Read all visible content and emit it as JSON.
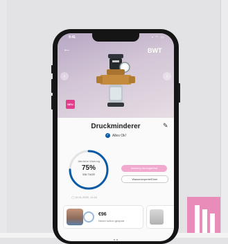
{
  "status_bar": {
    "time": "9:41",
    "icons": "▪ ◠ ▭"
  },
  "header": {
    "back_label": "←",
    "brand": "BWT"
  },
  "hero": {
    "prev_label": "‹",
    "next_label": "›",
    "sticker_text": "NEU"
  },
  "device": {
    "title": "Druckminderer",
    "status": "Alles Ok!"
  },
  "maintenance": {
    "caption": "Jährliche Wartung",
    "percent_text": "75%",
    "progress_fraction": 0.75,
    "days_text": "336 TAGE",
    "date_text": "10.01.2025, 14:24",
    "primary_action": "Wartung durchgeführt",
    "secondary_action": "Wasserexperte/Einer"
  },
  "savings_card": {
    "amount": "€96",
    "subtitle": "Neuer schon gespart"
  },
  "colors": {
    "accent_pink": "#e98cb9",
    "brand_blue": "#0a5aa5",
    "ring_blue": "#0a5aa5"
  }
}
